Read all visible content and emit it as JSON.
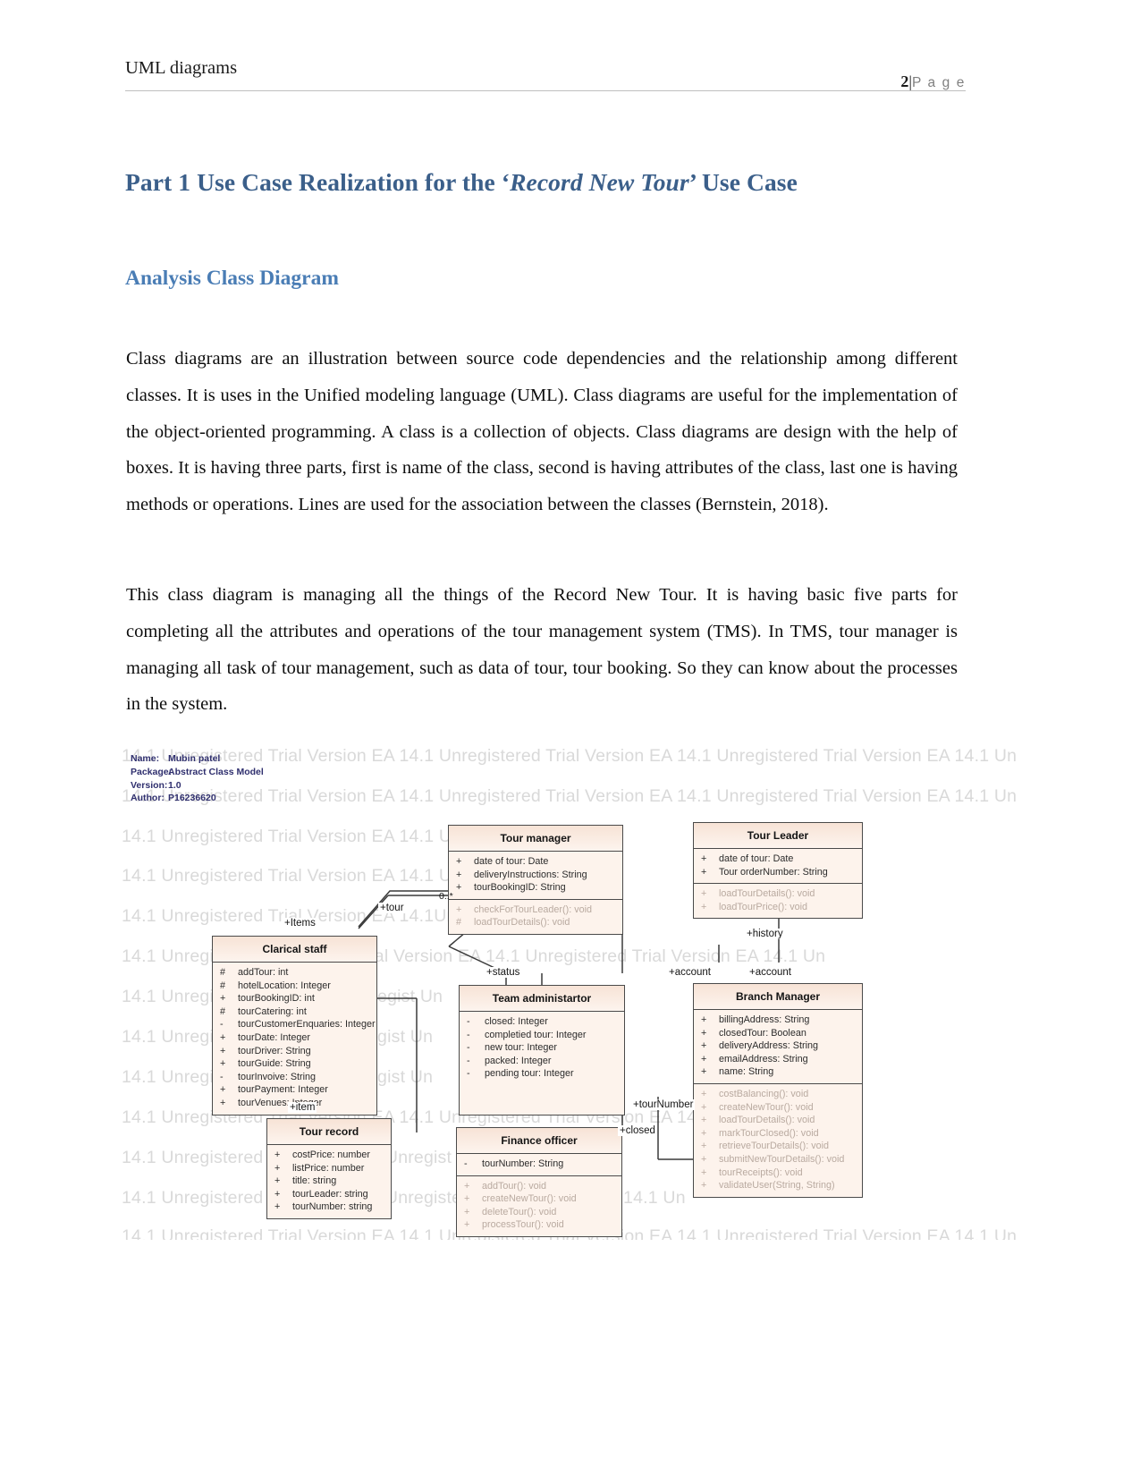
{
  "header": {
    "left_title": "UML diagrams",
    "page_number": "2",
    "separator": "|",
    "page_word": "P a g e"
  },
  "headings": {
    "h1_part1": "Part 1 Use Case Realization for the ‘",
    "h1_italic": "Record New Tour",
    "h1_part2": "’ Use Case",
    "h2": "Analysis Class Diagram"
  },
  "body": {
    "paragraph_1": "Class diagrams are an illustration between source code dependencies and the relationship among different classes. It is uses in the Unified modeling language (UML). Class diagrams are useful for the implementation of the object-oriented programming. A class is a collection of objects. Class diagrams are design with the help of boxes. It is having three parts, first is name of the class, second is having attributes of the class, last one is having methods or operations.   Lines are used for the association between the classes (Bernstein, 2018).",
    "paragraph_2": "This class diagram is managing all the things of the Record New Tour. It is having basic five parts for completing all the attributes and operations of the tour management system (TMS). In TMS, tour manager is managing all task of tour management, such as data of tour, tour booking. So they can know about the processes in the system."
  },
  "diagram": {
    "watermark_text": "14.1 Unregistered Trial Version  EA 14.1 Unregistered Trial Version  EA 14.1 Unregistered Trial Version  EA 14.1 Un",
    "watermark_rows": [
      "14.1 Unregistered Trial Version  EA 14.1 Unregistered Trial Version  EA 14.1 Unregistered Trial Version  EA 14.1 Un",
      "14.1 Unregistered Trial Version  EA 14.1 Unregistered Trial Version  EA 14.1 Unregistered Trial Version  EA 14.1 Un",
      "14.1 Unregistered Trial Version  EA 14.1 Unregis                      Unregist                     Un",
      "14.1 Unregistered Trial Version  EA 14.1 Unregis                      Unregist                     Un",
      "14.1 Unregistered Trial Version  EA 14.1Unregis                       Unregist                     Un",
      "14.1 Unregis                 .1 Unregistered Trial Version  EA 14.1 Unregistered Trial Version  EA 14.1 Un",
      "14.1 Unregis                 .1 Unregist                   4.1 Unregist                    Un",
      "14.1 Unregis                 .1 Unregist                   .1 Unregist                     Un",
      "14.1 Unregis                 .1 Unregist                   .1 Unregist                     Un",
      "14.1 Unregistered Trial Version  EA 14.1 Unregistered Trial Version  EA 14.1 Unregist                Un",
      "14.1 Unregistered Tr                Unregiste                  1 Unregist                     Un",
      "14.1 Unregistered Tr                Unregiste                  1 Unregistered Trial Version  EA 14.1 Un",
      "14.1 Unregistered Trial Version  EA 14.1 Unregistered Trial Version  EA 14.1 Unregistered Trial Version  EA 14.1 Un"
    ],
    "metadata": [
      {
        "key": "Name:",
        "value": "Mubin patel"
      },
      {
        "key": "Package:",
        "value": "Abstract Class Model"
      },
      {
        "key": "Version:",
        "value": "1.0"
      },
      {
        "key": "Author:",
        "value": "P16236620"
      }
    ],
    "classes": [
      {
        "id": "tour-manager",
        "name": "Tour manager",
        "attributes": [
          {
            "vis": "+",
            "text": "date of tour: Date"
          },
          {
            "vis": "+",
            "text": "deliveryInstructions: String"
          },
          {
            "vis": "+",
            "text": "tourBookingID: String"
          }
        ],
        "operations": [
          {
            "vis": "+",
            "text": "checkForTourLeader(): void"
          },
          {
            "vis": "#",
            "text": "loadTourDetails(): void"
          }
        ]
      },
      {
        "id": "tour-leader",
        "name": "Tour Leader",
        "attributes": [
          {
            "vis": "+",
            "text": "date of tour: Date"
          },
          {
            "vis": "+",
            "text": "Tour orderNumber: String"
          }
        ],
        "operations": [
          {
            "vis": "+",
            "text": "loadTourDetails(): void"
          },
          {
            "vis": "+",
            "text": "loadTourPrice(): void"
          }
        ]
      },
      {
        "id": "clarical-staff",
        "name": "Clarical staff",
        "attributes": [
          {
            "vis": "#",
            "text": "addTour: int"
          },
          {
            "vis": "#",
            "text": "hotelLocation: Integer"
          },
          {
            "vis": "+",
            "text": "tourBookingID: int"
          },
          {
            "vis": "#",
            "text": "tourCatering: int"
          },
          {
            "vis": "-",
            "text": "tourCustomerEnquaries: Integer"
          },
          {
            "vis": "+",
            "text": "tourDate: Integer"
          },
          {
            "vis": "+",
            "text": "tourDriver: String"
          },
          {
            "vis": "+",
            "text": "tourGuide: String"
          },
          {
            "vis": "-",
            "text": "tourInvoive: String"
          },
          {
            "vis": "+",
            "text": "tourPayment: Integer"
          },
          {
            "vis": "+",
            "text": "tourVenues: Integer"
          }
        ],
        "operations": []
      },
      {
        "id": "team-administartor",
        "name": "Team administartor",
        "attributes": [
          {
            "vis": "-",
            "text": "closed: Integer"
          },
          {
            "vis": "-",
            "text": "completied tour: Integer"
          },
          {
            "vis": "-",
            "text": "new tour: Integer"
          },
          {
            "vis": "-",
            "text": "packed: Integer"
          },
          {
            "vis": "-",
            "text": "pending tour: Integer"
          }
        ],
        "operations": []
      },
      {
        "id": "branch-manager",
        "name": "Branch Manager",
        "attributes": [
          {
            "vis": "+",
            "text": "billingAddress: String"
          },
          {
            "vis": "+",
            "text": "closedTour: Boolean"
          },
          {
            "vis": "+",
            "text": "deliveryAddress: String"
          },
          {
            "vis": "+",
            "text": "emailAddress: String"
          },
          {
            "vis": "+",
            "text": "name: String"
          }
        ],
        "operations": [
          {
            "vis": "+",
            "text": "costBalancing(): void"
          },
          {
            "vis": "+",
            "text": "createNewTour(): void"
          },
          {
            "vis": "+",
            "text": "loadTourDetails(): void"
          },
          {
            "vis": "+",
            "text": "markTourClosed(): void"
          },
          {
            "vis": "+",
            "text": "retrieveTourDetails(): void"
          },
          {
            "vis": "+",
            "text": "submitNewTourDetails(): void"
          },
          {
            "vis": "+",
            "text": "tourReceipts(): void"
          },
          {
            "vis": "+",
            "text": "validateUser(String, String)"
          }
        ]
      },
      {
        "id": "tour-record",
        "name": "Tour record",
        "attributes": [
          {
            "vis": "+",
            "text": "costPrice: number"
          },
          {
            "vis": "+",
            "text": "listPrice: number"
          },
          {
            "vis": "+",
            "text": "title: string"
          },
          {
            "vis": "+",
            "text": "tourLeader: string"
          },
          {
            "vis": "+",
            "text": "tourNumber: string"
          }
        ],
        "operations": []
      },
      {
        "id": "finance-officer",
        "name": "Finance officer",
        "attributes": [
          {
            "vis": "-",
            "text": "tourNumber: String"
          }
        ],
        "operations": [
          {
            "vis": "+",
            "text": "addTour(): void"
          },
          {
            "vis": "+",
            "text": "createNewTour(): void"
          },
          {
            "vis": "+",
            "text": "deleteTour(): void"
          },
          {
            "vis": "+",
            "text": "processTour(): void"
          }
        ]
      }
    ],
    "connector_labels": [
      {
        "id": "items",
        "text": "+Items"
      },
      {
        "id": "tour",
        "text": "+tour"
      },
      {
        "id": "multiplicity",
        "text": "0..*"
      },
      {
        "id": "status",
        "text": "+status"
      },
      {
        "id": "history",
        "text": "+history"
      },
      {
        "id": "account-left",
        "text": "+account"
      },
      {
        "id": "account-right",
        "text": "+account"
      },
      {
        "id": "item",
        "text": "+item"
      },
      {
        "id": "tournumber",
        "text": "+tourNumber"
      },
      {
        "id": "closed",
        "text": "+closed"
      }
    ]
  }
}
